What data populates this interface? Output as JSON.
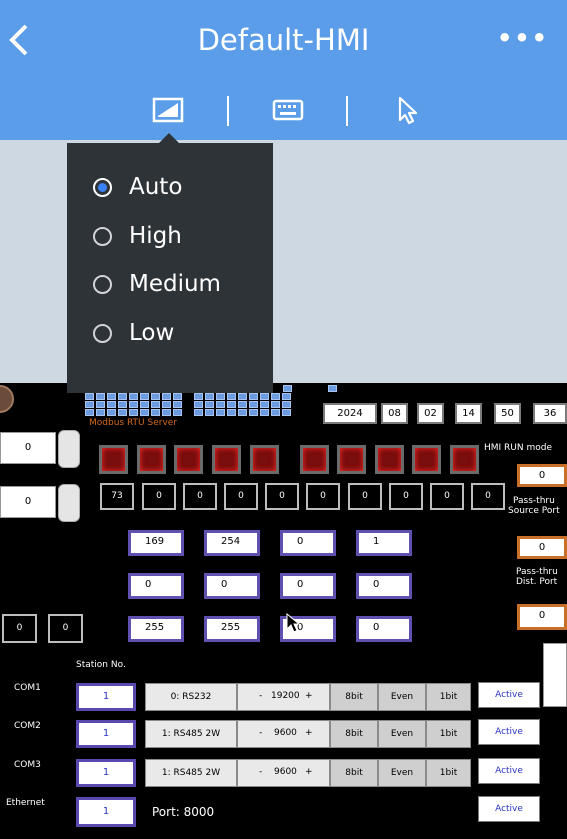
{
  "header": {
    "title": "Default-HMI",
    "more": "•••"
  },
  "quality_menu": {
    "options": [
      "Auto",
      "High",
      "Medium",
      "Low"
    ],
    "selected": "Auto"
  },
  "hmi": {
    "server_label": "Modbus RTU Server",
    "date": [
      "2024",
      "08",
      "02",
      "14",
      "50",
      "36"
    ],
    "spin1": "0",
    "spin2": "0",
    "run_mode_label": "HMI RUN mode",
    "zero_row": [
      "73",
      "0",
      "0",
      "0",
      "0",
      "0",
      "0",
      "0",
      "0",
      "0"
    ],
    "grid": [
      [
        "169",
        "254",
        "0",
        "1"
      ],
      [
        "0",
        "0",
        "0",
        "0"
      ],
      [
        "255",
        "255",
        "0",
        "0"
      ]
    ],
    "left_small": [
      "0",
      "0"
    ],
    "orange_values": [
      "0",
      "0",
      "0"
    ],
    "pass_src": [
      "Pass-thru",
      "Source Port"
    ],
    "pass_dst": [
      "Pass-thru",
      "Dist. Port"
    ],
    "station_label": "Station No.",
    "coms": [
      {
        "name": "COM1",
        "station": "1",
        "mode": "0: RS232",
        "minus": "-",
        "baud": "19200",
        "plus": "+",
        "bits": "8bit",
        "parity": "Even",
        "stop": "1bit",
        "active": "Active"
      },
      {
        "name": "COM2",
        "station": "1",
        "mode": "1: RS485 2W",
        "minus": "-",
        "baud": "9600",
        "plus": "+",
        "bits": "8bit",
        "parity": "Even",
        "stop": "1bit",
        "active": "Active"
      },
      {
        "name": "COM3",
        "station": "1",
        "mode": "1: RS485 2W",
        "minus": "-",
        "baud": "9600",
        "plus": "+",
        "bits": "8bit",
        "parity": "Even",
        "stop": "1bit",
        "active": "Active"
      }
    ],
    "ethernet": {
      "name": "Ethernet",
      "station": "1",
      "port": "Port: 8000",
      "active": "Active"
    }
  }
}
